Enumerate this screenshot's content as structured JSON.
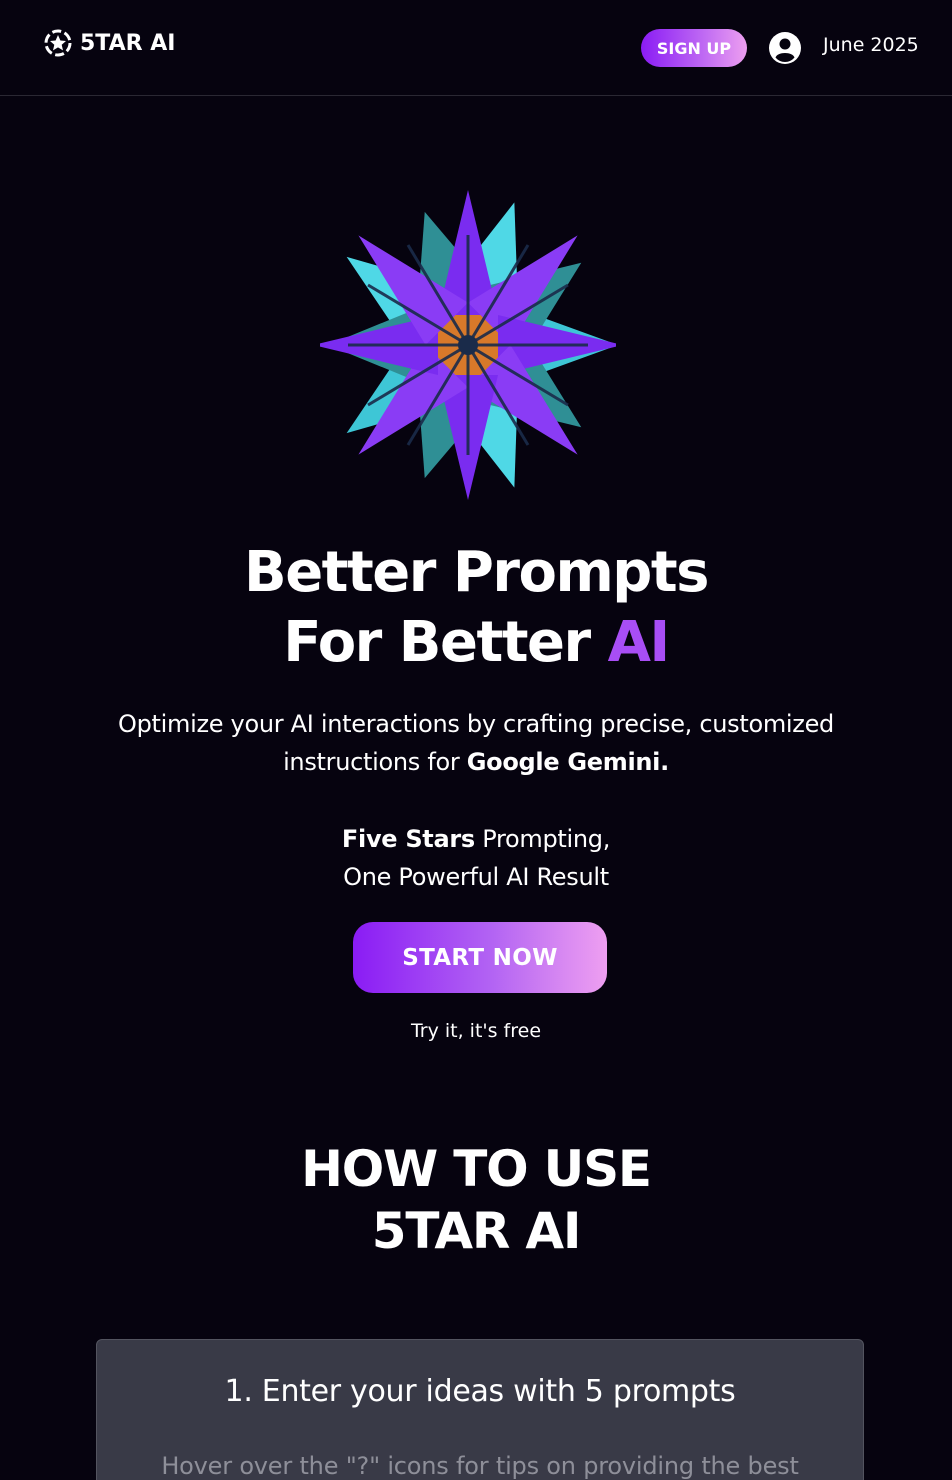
{
  "header": {
    "logo_text": "5TAR AI",
    "signup_label": "SIGN UP",
    "date": "June 2025"
  },
  "hero": {
    "title_line1": "Better Prompts",
    "title_line2_prefix": "For Better ",
    "title_line2_accent": "AI",
    "subtitle_prefix": "Optimize your AI interactions by crafting precise, customized instructions for ",
    "subtitle_bold": "Google Gemini.",
    "tagline_bold": "Five Stars",
    "tagline_rest": " Prompting,",
    "tagline_line2": "One Powerful AI Result",
    "cta_label": "START NOW",
    "cta_note": "Try it, it's free"
  },
  "howto": {
    "title_line1": "HOW TO USE",
    "title_line2": "5TAR AI",
    "step1_heading": "1. Enter your ideas with 5 prompts",
    "step1_desc": "Hover over the \"?\" icons for tips on providing the best"
  },
  "colors": {
    "background": "#06030f",
    "accent": "#a84ef5",
    "gradient_start": "#8a1cf4",
    "gradient_end": "#ee9ff1",
    "card": "#393a47"
  },
  "icons": {
    "logo": "star-badge-icon",
    "account": "account-circle-icon"
  }
}
